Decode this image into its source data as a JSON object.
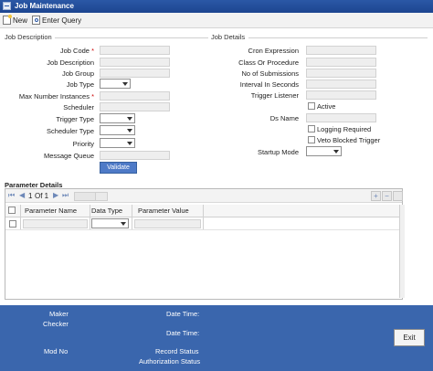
{
  "window": {
    "title": "Job Maintenance"
  },
  "toolbar": {
    "new_label": "New",
    "query_label": "Enter Query"
  },
  "job_description": {
    "section_title": "Job Description",
    "job_code": "Job Code",
    "job_description": "Job Description",
    "job_group": "Job Group",
    "job_type": "Job Type",
    "max_instances": "Max Number Instances",
    "scheduler": "Scheduler",
    "trigger_type": "Trigger Type",
    "scheduler_type": "Scheduler Type",
    "priority": "Priority",
    "message_queue": "Message Queue",
    "validate_label": "Validate",
    "required_mark": "*"
  },
  "job_details": {
    "section_title": "Job Details",
    "cron_expression": "Cron Expression",
    "class_or_procedure": "Class Or Procedure",
    "no_of_submissions": "No of Submissions",
    "interval_in_seconds": "Interval In Seconds",
    "trigger_listener": "Trigger Listener",
    "active": "Active",
    "ds_name": "Ds Name",
    "logging_required": "Logging Required",
    "veto_blocked_trigger": "Veto Blocked Trigger",
    "startup_mode": "Startup Mode"
  },
  "parameter_details": {
    "section_title": "Parameter Details",
    "pager": {
      "first": "⏮",
      "prev": "◀",
      "page": "1",
      "of_text": "Of 1",
      "next": "▶",
      "last": "⏭"
    },
    "columns": [
      "Parameter Name",
      "Data Type",
      "Parameter Value"
    ],
    "add_icon": "+",
    "remove_icon": "−"
  },
  "footer": {
    "maker": "Maker",
    "checker": "Checker",
    "date_time": "Date Time:",
    "mod_no": "Mod No",
    "record_status": "Record Status",
    "authorization_status": "Authorization Status",
    "exit_label": "Exit"
  }
}
